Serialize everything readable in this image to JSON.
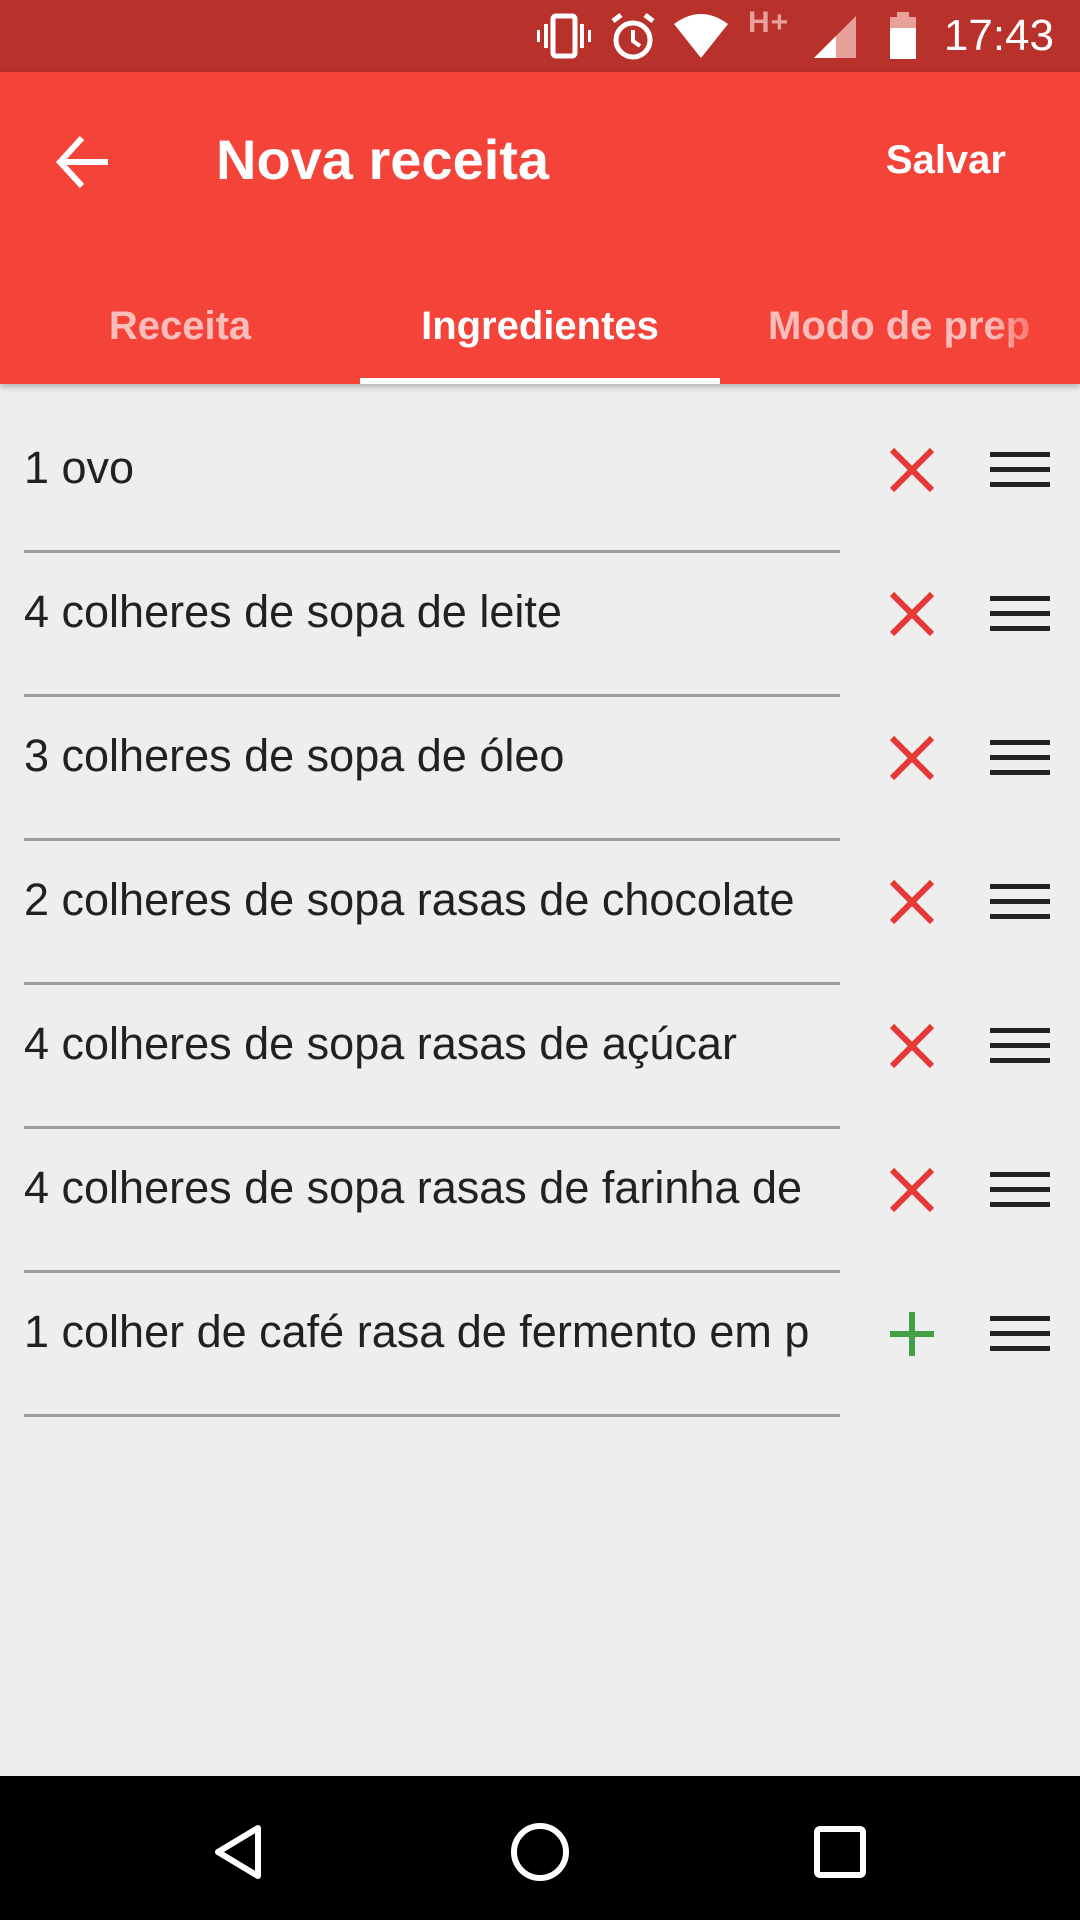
{
  "status_bar": {
    "time": "17:43",
    "network_type": "H+",
    "icons": [
      "vibrate-icon",
      "alarm-icon",
      "wifi-icon",
      "signal-icon",
      "battery-icon"
    ]
  },
  "app_bar": {
    "title": "Nova receita",
    "save_label": "Salvar",
    "back_icon": "arrow-back-icon"
  },
  "tabs": [
    {
      "label": "Receita",
      "active": false
    },
    {
      "label": "Ingredientes",
      "active": true
    },
    {
      "label": "Modo de prep",
      "active": false
    }
  ],
  "ingredients": [
    {
      "text": "1 ovo",
      "action": "remove"
    },
    {
      "text": "4 colheres de sopa de leite",
      "action": "remove"
    },
    {
      "text": "3 colheres de sopa de óleo",
      "action": "remove"
    },
    {
      "text": "2 colheres de sopa rasas de chocolate",
      "action": "remove"
    },
    {
      "text": "4 colheres de sopa rasas de açúcar",
      "action": "remove"
    },
    {
      "text": "4 colheres de sopa rasas de farinha de",
      "action": "remove"
    },
    {
      "text": "1 colher de café rasa de fermento em p",
      "action": "add"
    }
  ],
  "colors": {
    "status_bar": "#b8312b",
    "app_bar": "#f4443a",
    "remove_icon": "#e53935",
    "add_icon": "#43a047"
  },
  "nav_bar": {
    "icons": [
      "back-triangle-icon",
      "home-circle-icon",
      "recents-square-icon"
    ]
  }
}
